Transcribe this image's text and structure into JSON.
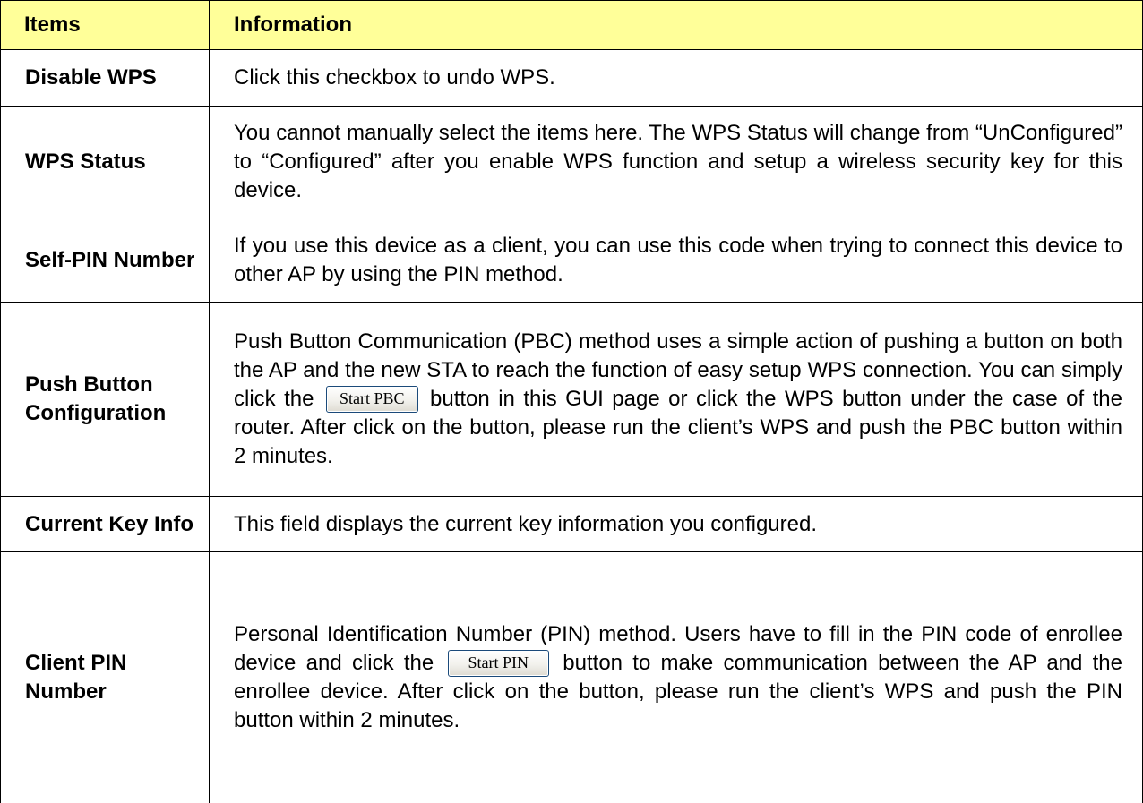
{
  "table": {
    "header": {
      "items": "Items",
      "information": "Information"
    },
    "rows": [
      {
        "item": "Disable WPS",
        "info": "Click this checkbox to undo WPS."
      },
      {
        "item": "WPS Status",
        "info": "You cannot manually select the items here. The WPS Status will change from “UnConfigured” to “Configured” after you enable WPS function and setup a wireless security key for this device."
      },
      {
        "item": "Self-PIN Number",
        "info": "If you use this device as a client, you can use this code when trying to connect this device to other AP by using the PIN method."
      },
      {
        "item": "Push Button Configuration",
        "info_before": "Push Button Communication (PBC) method uses a simple action of pushing a button on both the AP and the new STA to reach the function of easy setup WPS connection. You can simply click the",
        "button_label": "Start PBC",
        "info_after": "button in this GUI page or click the WPS button under the case of the router. After click on the button, please run the client’s WPS and push the PBC button within 2 minutes."
      },
      {
        "item": "Current Key Info",
        "info": "This field displays the current key information you configured."
      },
      {
        "item": "Client PIN Number",
        "info_before": "Personal Identification Number (PIN) method. Users have to fill in the PIN code of enrollee device and click the",
        "button_label": "Start PIN",
        "info_after": "button to make communication between the AP and the enrollee device. After click on the button, please run the client’s WPS and push the PIN button within 2 minutes."
      }
    ]
  },
  "colors": {
    "header_background": "#ffff99",
    "border": "#000000"
  }
}
